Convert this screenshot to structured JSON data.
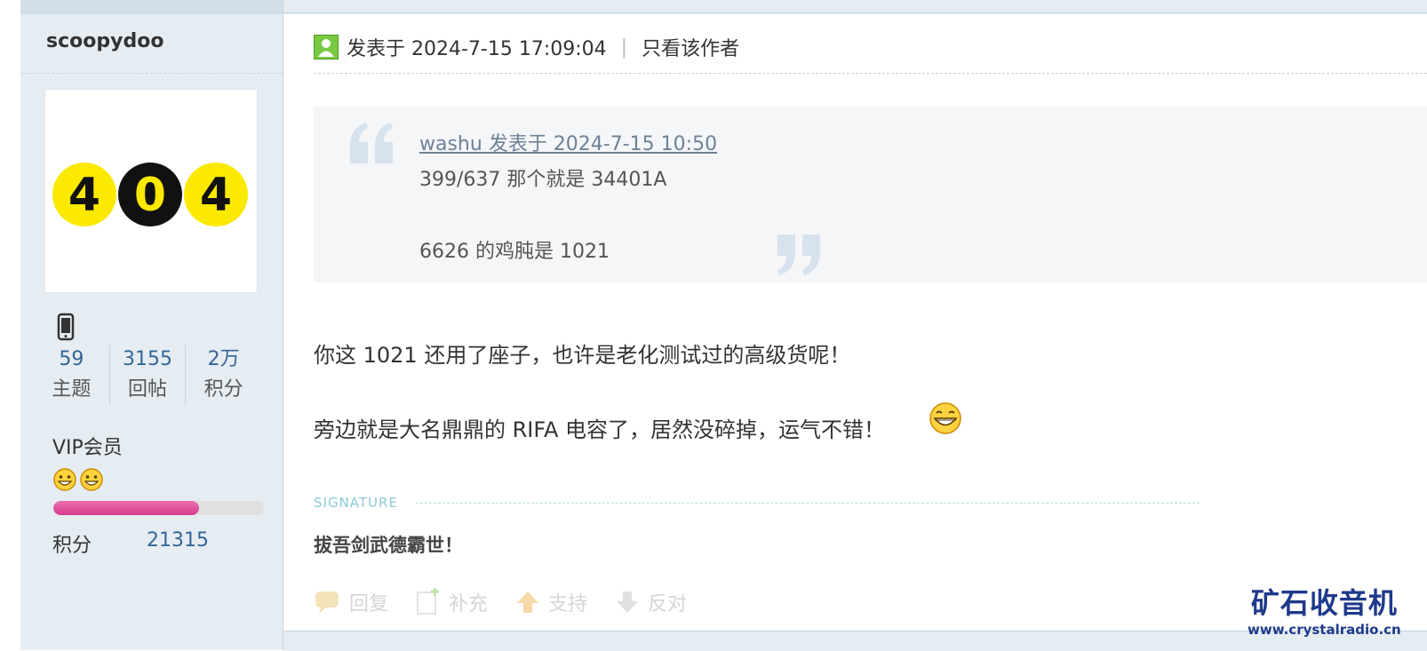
{
  "sidebar": {
    "username": "scoopydoo",
    "avatar_text": "404",
    "stats": [
      {
        "value": "59",
        "label": "主题"
      },
      {
        "value": "3155",
        "label": "回帖"
      },
      {
        "value": "2万",
        "label": "积分"
      }
    ],
    "group": "VIP会员",
    "level_progress": 0.69,
    "credit_label": "积分",
    "credit_value": "21315",
    "icons": [
      "mobile-icon",
      "smiley-icon"
    ]
  },
  "post": {
    "time": "发表于 2024-7-15 17:09:04",
    "separator": "|",
    "only_author": "只看该作者",
    "quote": {
      "author_line": "washu 发表于 2024-7-15 10:50",
      "line1": "399/637 那个就是 34401A",
      "line2": "6626 的鸡肫是 1021"
    },
    "body_line1": "你这 1021 还用了座子，也许是老化测试过的高级货呢！",
    "body_line2": "旁边就是大名鼎鼎的 RIFA 电容了，居然没碎掉，运气不错！",
    "signature_label": "SIGNATURE",
    "signature_text": "拔吾剑武德霸世！",
    "actions": {
      "reply": "回复",
      "supplement": "补充",
      "support": "支持",
      "oppose": "反对"
    }
  },
  "watermark": {
    "cn": "矿石收音机",
    "url": "www.crystalradio.cn"
  },
  "colors": {
    "sidebar_bg": "#e5edf2",
    "link_blue": "#336699",
    "progress_pink": "#d63a8c",
    "watermark_blue": "#1e3a8a"
  }
}
